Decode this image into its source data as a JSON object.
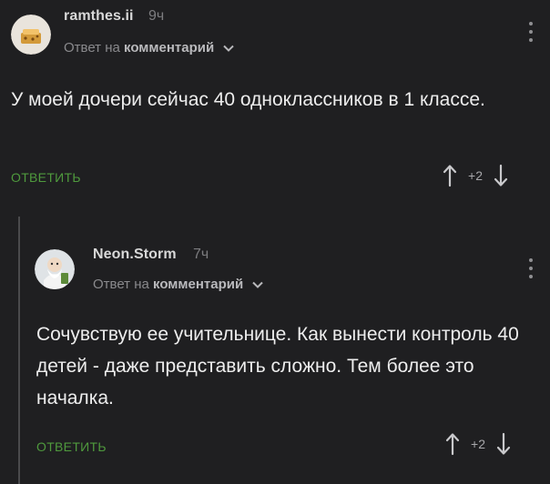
{
  "comments": [
    {
      "username": "ramthes.ii",
      "time": "9ч",
      "reply_prefix": "Ответ на",
      "reply_target": "комментарий",
      "text": "У моей дочери сейчас 40 одноклассников в 1 классе.",
      "reply_label": "ОТВЕТИТЬ",
      "rating": "+2"
    },
    {
      "username": "Neon.Storm",
      "time": "7ч",
      "reply_prefix": "Ответ на",
      "reply_target": "комментарий",
      "text": "Сочувствую ее учительнице. Как вынести контроль 40 детей - даже представить сложно. Тем более это началка.",
      "reply_label": "ОТВЕТИТЬ",
      "rating": "+2"
    }
  ],
  "icons": {
    "upvote": "arrow-up-icon",
    "downvote": "arrow-down-icon",
    "menu": "more-vertical-icon",
    "chevron": "chevron-down-icon"
  },
  "colors": {
    "background": "#1f1f21",
    "reply_accent": "#4f9a3d",
    "thread_line": "#4a4a4c"
  }
}
